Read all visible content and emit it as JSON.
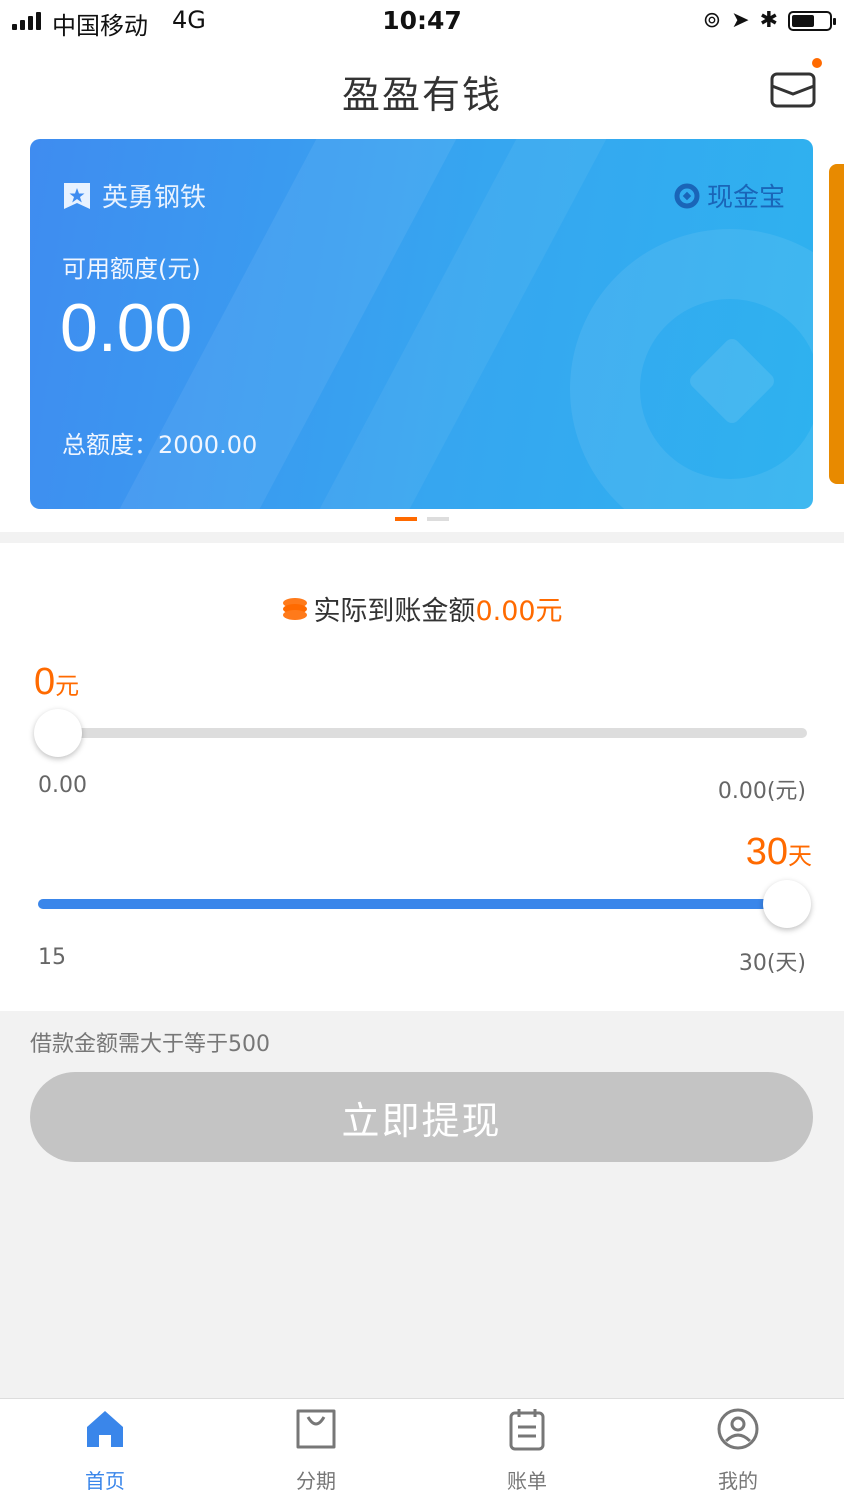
{
  "status_bar": {
    "carrier": "中国移动",
    "network": "4G",
    "time": "10:47"
  },
  "header": {
    "title": "盈盈有钱",
    "message_icon": "envelope-icon"
  },
  "card": {
    "company": "英勇钢铁",
    "brand": "现金宝",
    "available_label": "可用额度(元)",
    "available_amount": "0.00",
    "total_text": "总额度：2000.00",
    "pager_count": 2,
    "pager_active": 0
  },
  "loan": {
    "receive_label": "实际到账金额",
    "receive_value": "0.00元",
    "amount": {
      "value": "0",
      "unit": "元",
      "min_label": "0.00",
      "max_label": "0.00(元)",
      "level": 0
    },
    "days": {
      "value": "30",
      "unit": "天",
      "min_label": "15",
      "max_label": "30(天)",
      "level": 1
    }
  },
  "hint": "借款金额需大于等于500",
  "submit_label": "立即提现",
  "tabs": [
    {
      "label": "首页",
      "icon": "home-icon",
      "active": true
    },
    {
      "label": "分期",
      "icon": "shopping-bag-icon",
      "active": false
    },
    {
      "label": "账单",
      "icon": "bill-icon",
      "active": false
    },
    {
      "label": "我的",
      "icon": "user-icon",
      "active": false
    }
  ],
  "colors": {
    "accent": "#3a86ea",
    "highlight": "#ff6a00",
    "button_disabled": "#c4c4c4"
  }
}
